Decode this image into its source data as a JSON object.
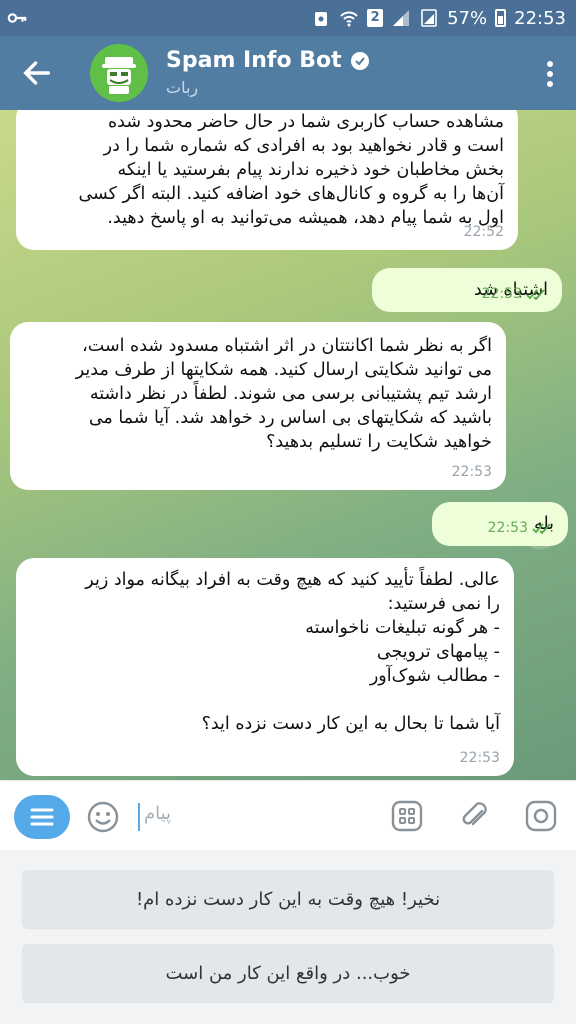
{
  "status_bar": {
    "signal_badge": "2",
    "battery_percent": "57%",
    "time": "22:53"
  },
  "header": {
    "title": "Spam Info Bot",
    "subtitle": "ربات",
    "colors": {
      "bar": "#527da3",
      "status": "#4a7097"
    }
  },
  "messages": [
    {
      "direction": "in",
      "text": "مشاهده حساب کاربری شما در حال حاضر محدود شده\nاست و قادر نخواهید بود به افرادی که شماره شما را در\nبخش مخاطبان خود ذخیره ندارند پیام بفرستید یا اینکه\nآن‌ها را به گروه و کانال‌های خود اضافه کنید. البته اگر کسی\nاول به شما پیام دهد، همیشه می‌توانید به او پاسخ دهید.",
      "time": "22:52"
    },
    {
      "direction": "out",
      "text": "اشتباه شد",
      "time": "22:53"
    },
    {
      "direction": "in",
      "text": "اگر به نظر شما اکانتتان در اثر اشتباه مسدود شده است،\nمی توانید شکایتی ارسال کنید. همه شکایتها از طرف مدیر\nارشد تیم پشتیبانی برسی می شوند. لطفاً در نظر داشته\nباشید که شکایتهای بی اساس رد خواهد شد. آیا شما می\nخواهید شکایت را تسلیم بدهید؟",
      "time": "22:53"
    },
    {
      "direction": "out",
      "text": "بله",
      "time": "22:53"
    },
    {
      "direction": "in",
      "text": "عالی. لطفاً تأیید کنید که هیچ وقت به افراد بیگانه مواد زیر\nرا نمی فرستید:\n- هر گونه تبلیغات ناخواسته\n- پیامهای ترویجی\n- مطالب شوک‌آور\n\nآیا شما تا بحال به این کار دست نزده اید؟",
      "time": "22:53"
    }
  ],
  "input": {
    "placeholder": "پیام"
  },
  "reply_keyboard": [
    "نخیر! هیچ وقت به این کار دست نزده ام!",
    "خوب... در واقع این کار من است"
  ],
  "icons": [
    "key-icon",
    "wifi-icon",
    "signal-icon",
    "battery-icon",
    "back-arrow-icon",
    "bot-avatar-icon",
    "verified-icon",
    "more-vert-icon",
    "keyboard-menu-icon",
    "emoji-icon",
    "commands-icon",
    "attach-icon",
    "camera-icon",
    "double-check-icon"
  ]
}
